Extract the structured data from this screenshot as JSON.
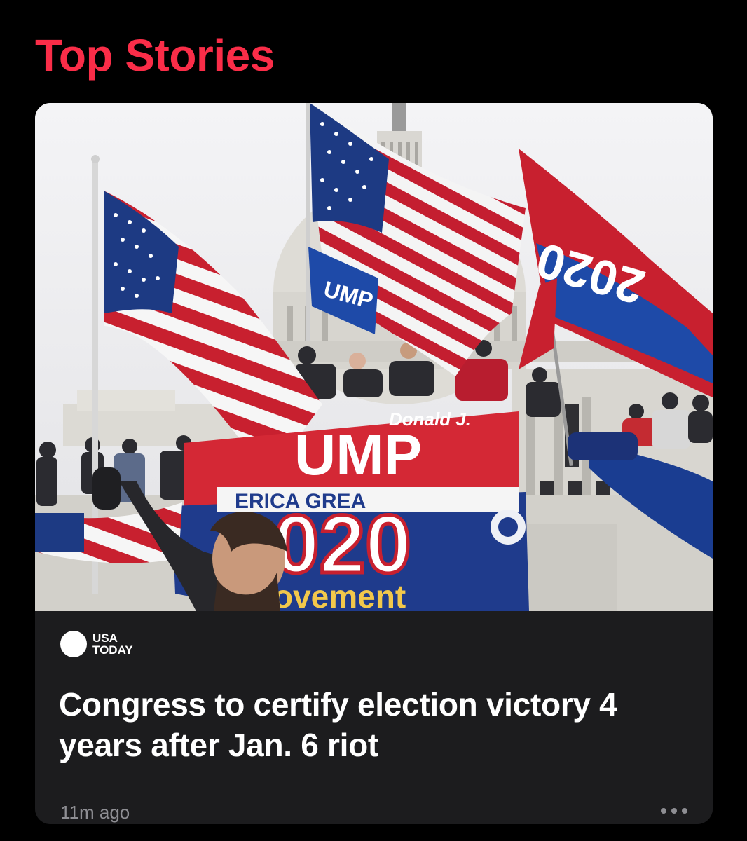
{
  "section": {
    "title": "Top Stories"
  },
  "story": {
    "image_alt": "Rioters with flags at the U.S. Capitol",
    "image_text": {
      "banner_top": "Donald J.",
      "banner_main": "UMP",
      "banner_sub": "ERICA GREA",
      "banner_year": "020",
      "banner_bottom": "ovement",
      "flag_text": "UMP",
      "flag_year": "2020"
    },
    "publisher": {
      "name": "USA TODAY",
      "line1": "USA",
      "line2": "TODAY"
    },
    "headline": "Congress to certify election victory 4 years after Jan. 6 riot",
    "timestamp": "11m ago"
  },
  "colors": {
    "accent": "#fa2d48",
    "card": "#1c1c1e",
    "muted": "#8e8e93"
  }
}
